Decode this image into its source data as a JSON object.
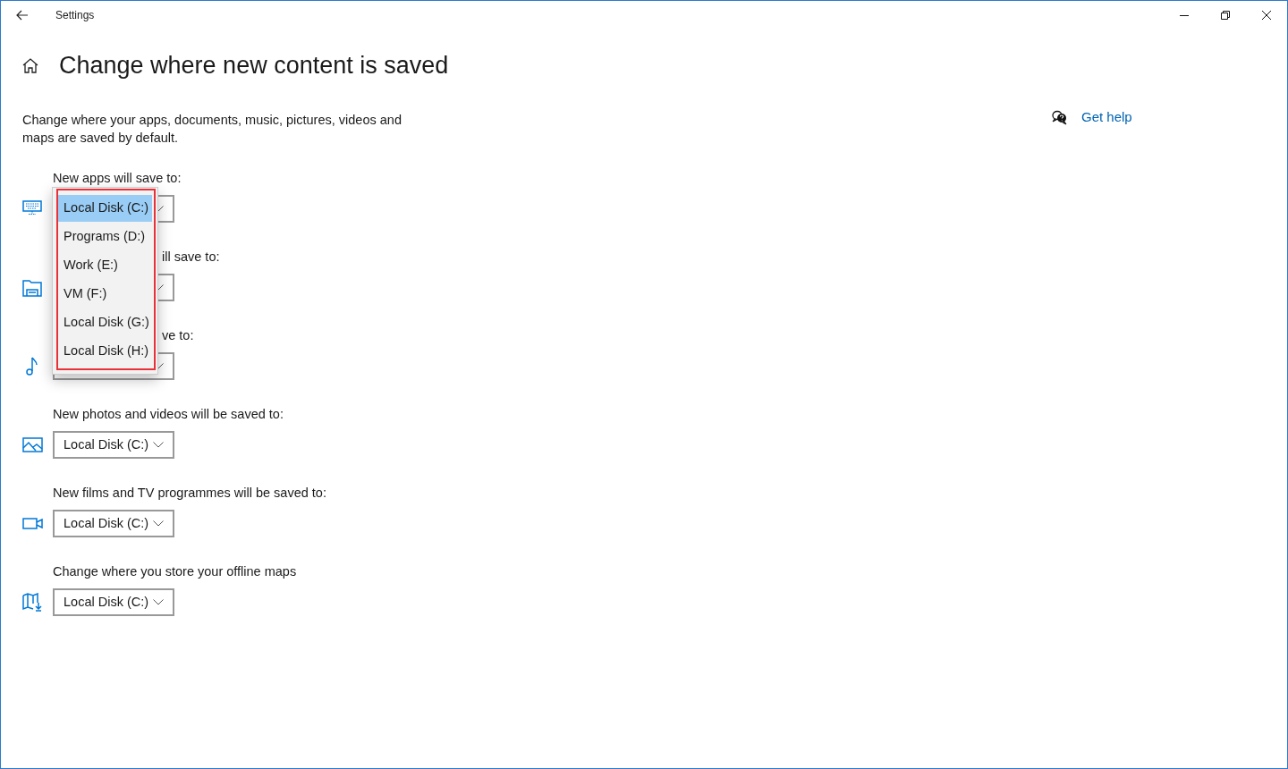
{
  "window": {
    "title": "Settings"
  },
  "page": {
    "title": "Change where new content is saved",
    "description": "Change where your apps, documents, music, pictures, videos and maps are saved by default."
  },
  "help_link": "Get help",
  "settings": [
    {
      "kind": "apps",
      "label": "New apps will save to:",
      "label_covered": false
    },
    {
      "kind": "documents",
      "label": "ill save to:",
      "label_covered": true
    },
    {
      "kind": "music",
      "label": "ve to:",
      "label_covered": true
    },
    {
      "kind": "photos",
      "label": "New photos and videos will be saved to:",
      "label_covered": false,
      "value": "Local Disk (C:)"
    },
    {
      "kind": "films",
      "label": "New films and TV programmes will be saved to:",
      "label_covered": false,
      "value": "Local Disk (C:)"
    },
    {
      "kind": "maps",
      "label": "Change where you store your offline maps",
      "label_covered": false,
      "value": "Local Disk (C:)"
    }
  ],
  "dropdown": {
    "options": [
      {
        "label": "Local Disk (C:)",
        "selected": true
      },
      {
        "label": "Programs (D:)",
        "selected": false
      },
      {
        "label": "Work (E:)",
        "selected": false
      },
      {
        "label": "VM (F:)",
        "selected": false
      },
      {
        "label": "Local Disk (G:)",
        "selected": false
      },
      {
        "label": "Local Disk (H:)",
        "selected": false
      }
    ]
  }
}
